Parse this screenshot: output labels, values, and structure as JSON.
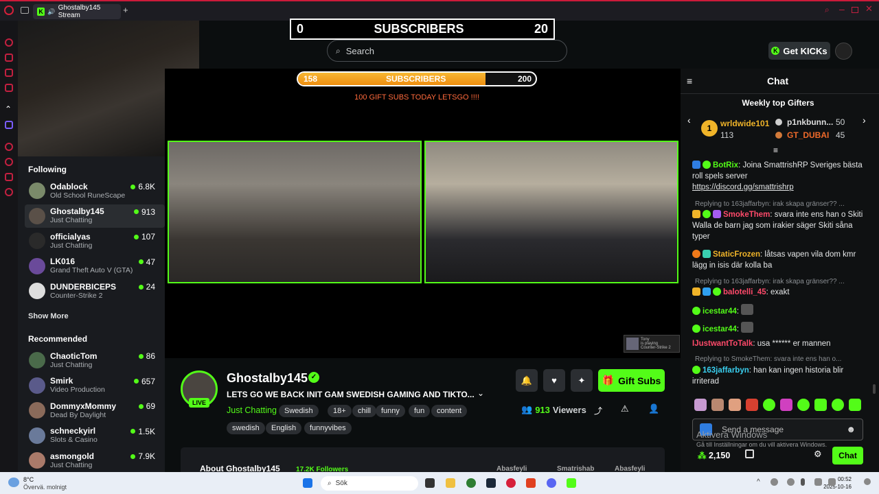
{
  "browser": {
    "tab_title": "Ghostalby145 Stream"
  },
  "overlay": {
    "counter_left": "0",
    "counter_label": "SUBSCRIBERS",
    "counter_right": "20",
    "goal_current": "158",
    "goal_label": "SUBSCRIBERS",
    "goal_target": "200",
    "goal_progress": 0.79,
    "gift_message": "100 GIFT SUBS TODAY LETSGO !!!!"
  },
  "header": {
    "search_placeholder": "Search",
    "get_kicks": "Get KICKs"
  },
  "sidebar": {
    "following_title": "Following",
    "following": [
      {
        "name": "Odablock",
        "category": "Old School RuneScape",
        "viewers": "6.8K"
      },
      {
        "name": "Ghostalby145",
        "category": "Just Chatting",
        "viewers": "913"
      },
      {
        "name": "officialyas",
        "category": "Just Chatting",
        "viewers": "107"
      },
      {
        "name": "LK016",
        "category": "Grand Theft Auto V (GTA)",
        "viewers": "47"
      },
      {
        "name": "DUNDERBICEPS",
        "category": "Counter-Strike 2",
        "viewers": "24"
      }
    ],
    "show_more": "Show More",
    "recommended_title": "Recommended",
    "recommended": [
      {
        "name": "ChaoticTom",
        "category": "Just Chatting",
        "viewers": "86"
      },
      {
        "name": "Smirk",
        "category": "Video Production",
        "viewers": "657"
      },
      {
        "name": "DommyxMommy",
        "category": "Dead By Daylight",
        "viewers": "69"
      },
      {
        "name": "schneckyirl",
        "category": "Slots & Casino",
        "viewers": "1.5K"
      },
      {
        "name": "asmongold",
        "category": "Just Chatting",
        "viewers": "7.9K"
      }
    ]
  },
  "mini_card": {
    "name": "Tony",
    "status": "is playing",
    "game": "Counter-Strike 2"
  },
  "channel": {
    "name": "Ghostalby145",
    "live": "LIVE",
    "title": "LETS GO WE BACK INIT GAM SWEDISH GAMING AND TIKTO...",
    "category": "Just Chatting",
    "tags": [
      "Swedish",
      "18+",
      "chill",
      "funny",
      "fun",
      "content",
      "swedish",
      "English",
      "funnyvibes"
    ],
    "viewers_count": "913",
    "viewers_label": "Viewers",
    "gift_subs": "Gift Subs",
    "about": "About Ghostalby145",
    "followers": "17.2K Followers",
    "socials": [
      "Abasfeyli",
      "Smatrishab",
      "Abasfeyli"
    ]
  },
  "chat": {
    "title": "Chat",
    "weekly_title": "Weekly top Gifters",
    "gifters": [
      {
        "name": "wrldwide101",
        "count": "113"
      },
      {
        "name": "p1nkbunn...",
        "count": "50"
      },
      {
        "name": "GT_DUBAI",
        "count": "45"
      }
    ],
    "rank": "1",
    "messages": [
      {
        "user": "BotRix",
        "text": ": Joina SmattrishRP Sveriges bästa roll spels server",
        "link": "https://discord.gg/smattrishrp"
      },
      {
        "reply": "Replying to 163jaffarbyn: irak skapa gränser?? ..."
      },
      {
        "user": "SmokeThem",
        "text": ": svara inte ens han o Skiti Walla de barn jag som irakier säger Skiti såna typer"
      },
      {
        "user": "StaticFrozen",
        "text": ": låtsas vapen vila dom kmr lägg in isis där kolla ba"
      },
      {
        "reply": "Replying to 163jaffarbyn: irak skapa gränser?? ..."
      },
      {
        "user": "balotelli_45",
        "text": ": exakt"
      },
      {
        "user": "icestar44",
        "text": ":"
      },
      {
        "user": "icestar44",
        "text": ":"
      },
      {
        "user": "IJustwantToTalk",
        "text": ": usa ****** er mannen"
      },
      {
        "reply": "Replying to SmokeThem: svara inte ens han o..."
      },
      {
        "user": "163jaffarbyn",
        "text": ": han kan ingen historia blir irriterad"
      }
    ],
    "send_placeholder": "Send a message",
    "points": "2,150",
    "send_button": "Chat",
    "colors": {
      "accent": "#53fc18",
      "gold": "#f0b429"
    }
  },
  "windows": {
    "activate_title": "Aktivera Windows",
    "activate_sub": "Gå till Inställningar om du vill aktivera Windows.",
    "weather_temp": "8°C",
    "weather_desc": "Övervä. molnigt",
    "search": "Sök",
    "time": "00:52",
    "date": "2025-10-16"
  }
}
